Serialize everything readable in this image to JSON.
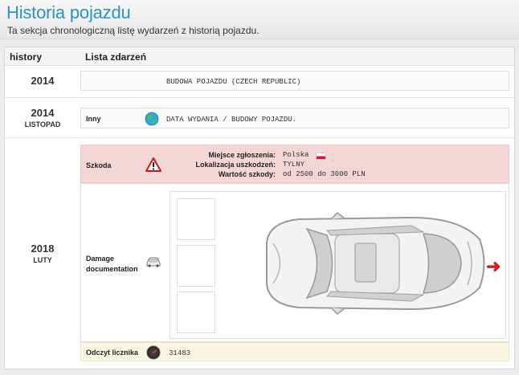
{
  "header": {
    "title": "Historia pojazdu",
    "subtitle": "Ta sekcja chronologiczną listę wydarzeń z historią pojazdu."
  },
  "table": {
    "col_history": "history",
    "col_events": "Lista zdarzeń"
  },
  "rows": [
    {
      "year": "2014",
      "month": "",
      "label": "",
      "text": "BUDOWA POJAZDU (CZECH REPUBLIC)"
    },
    {
      "year": "2014",
      "month": "LISTOPAD",
      "label": "Inny",
      "icon": "globe-icon",
      "text": "DATA WYDANIA / BUDOWY POJAZDU."
    }
  ],
  "row2018": {
    "year": "2018",
    "month": "LUTY",
    "damage": {
      "label": "Szkoda",
      "icon": "warning-icon",
      "place_key": "Miejsce zgłoszenia:",
      "place_val": "Polska",
      "loc_key": "Lokalizacja uszkodzeń:",
      "loc_val": "TYLNY",
      "value_key": "Wartość szkody:",
      "value_val": "od 2500 do 3000 PLN"
    },
    "documentation": {
      "label_line1": "Damage",
      "label_line2": "documentation",
      "icon": "car-icon"
    },
    "odometer": {
      "label": "Odczyt licznika",
      "icon": "speedometer-icon",
      "value": "31483"
    }
  },
  "colors": {
    "title": "#2b93c5",
    "damage_bg": "#f4d6d6",
    "odometer_bg": "#fbf6e3",
    "arrow": "#d51f1f"
  }
}
